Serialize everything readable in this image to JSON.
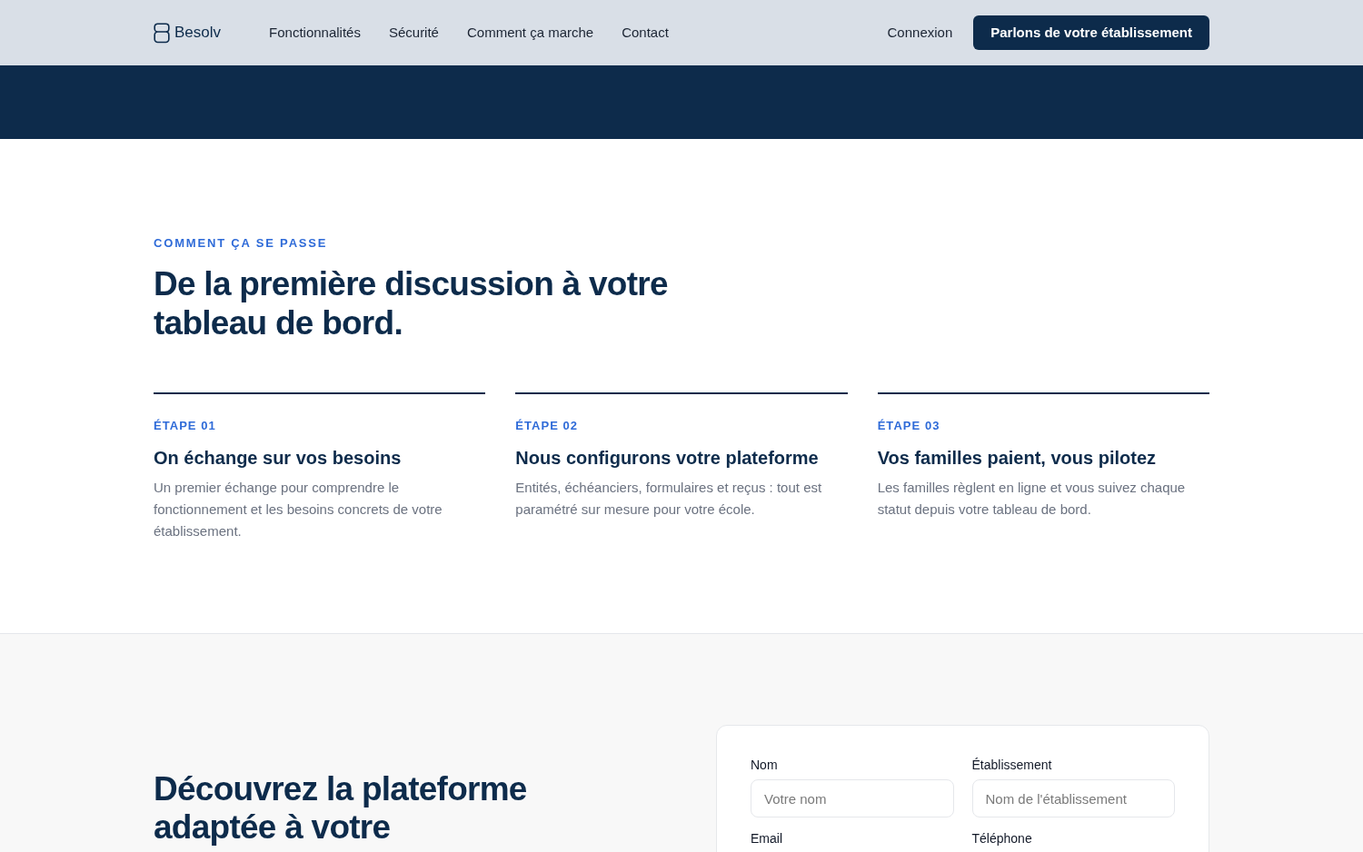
{
  "header": {
    "logo": "Besolv",
    "nav": [
      "Fonctionnalités",
      "Sécurité",
      "Comment ça marche",
      "Contact"
    ],
    "login": "Connexion",
    "cta": "Parlons de votre établissement"
  },
  "steps_section": {
    "eyebrow": "COMMENT ÇA SE PASSE",
    "title": "De la première discussion à votre tableau de bord.",
    "steps": [
      {
        "label": "ÉTAPE 01",
        "title": "On échange sur vos besoins",
        "text": "Un premier échange pour comprendre le fonctionnement et les besoins concrets de votre établissement."
      },
      {
        "label": "ÉTAPE 02",
        "title": "Nous configurons votre plateforme",
        "text": "Entités, échéanciers, formulaires et reçus : tout est paramétré sur mesure pour votre école."
      },
      {
        "label": "ÉTAPE 03",
        "title": "Vos familles paient, vous pilotez",
        "text": "Les familles règlent en ligne et vous suivez chaque statut depuis votre tableau de bord."
      }
    ]
  },
  "contact_section": {
    "title": "Découvrez la plateforme adaptée à votre",
    "form": {
      "fields": [
        {
          "label": "Nom",
          "placeholder": "Votre nom"
        },
        {
          "label": "Établissement",
          "placeholder": "Nom de l'établissement"
        },
        {
          "label": "Email"
        },
        {
          "label": "Téléphone"
        }
      ]
    }
  }
}
